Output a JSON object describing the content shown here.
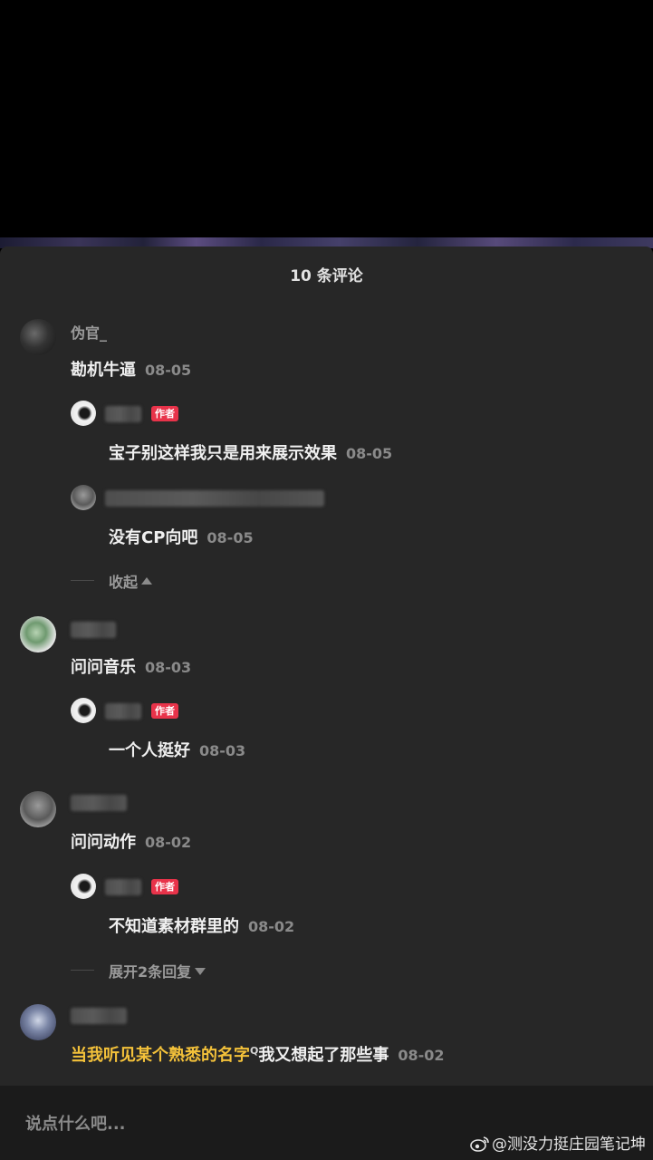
{
  "sheet": {
    "title": "10 条评论"
  },
  "comments": [
    {
      "user": "伪官_",
      "text": "勘机牛逼",
      "date": "08-05",
      "replies": [
        {
          "badge": "作者",
          "text": "宝子别这样我只是用来展示效果",
          "date": "08-05"
        },
        {
          "text": "没有CP向吧",
          "date": "08-05"
        }
      ],
      "toggle_label": "收起"
    },
    {
      "text": "问问音乐",
      "date": "08-03",
      "replies": [
        {
          "badge": "作者",
          "text": "一个人挺好",
          "date": "08-03"
        }
      ]
    },
    {
      "text": "问问动作",
      "date": "08-02",
      "replies": [
        {
          "badge": "作者",
          "text": "不知道素材群里的",
          "date": "08-02"
        }
      ],
      "toggle_label": "展开2条回复"
    },
    {
      "lyric": "当我听见某个熟悉的名字",
      "lyric_mark": "Q",
      "text": "我又想起了那些事",
      "date": "08-02"
    }
  ],
  "input": {
    "placeholder": "说点什么吧..."
  },
  "watermark": {
    "text": "@测没力挺庄园笔记坤",
    "icon": "weibo-icon"
  }
}
